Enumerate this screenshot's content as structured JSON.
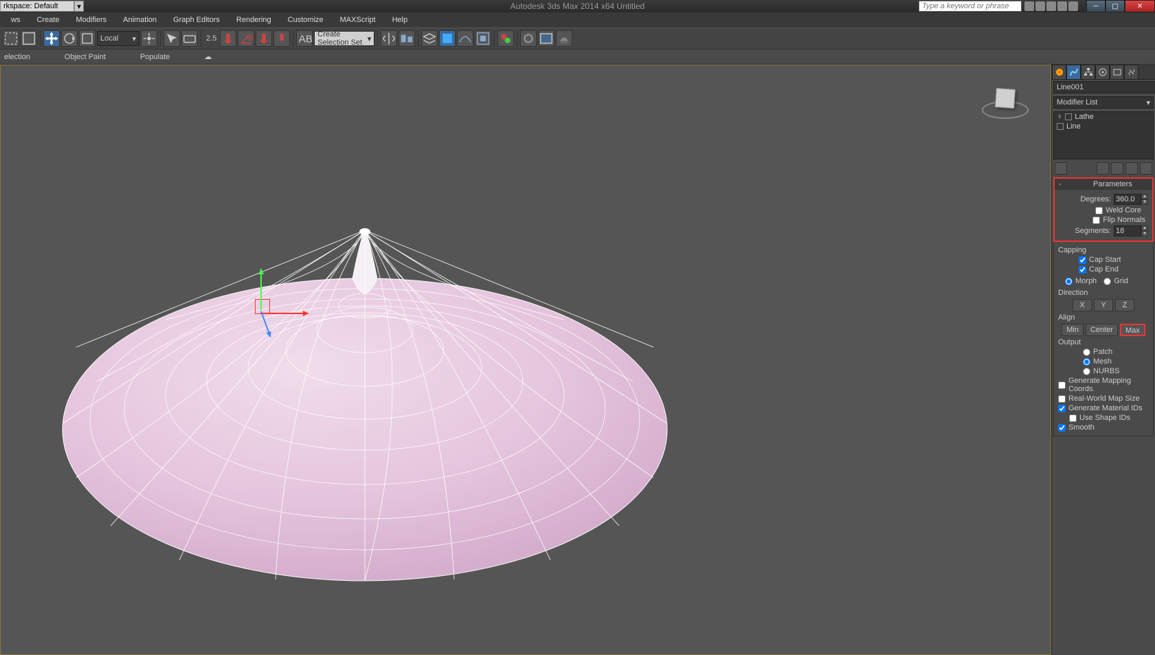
{
  "titlebar": {
    "workspace_label": "rkspace: Default",
    "app_title": "Autodesk 3ds Max 2014 x64   Untitled",
    "search_placeholder": "Type a keyword or phrase"
  },
  "menu": {
    "items": [
      "ws",
      "Create",
      "Modifiers",
      "Animation",
      "Graph Editors",
      "Rendering",
      "Customize",
      "MAXScript",
      "Help"
    ]
  },
  "toolbar": {
    "coord_system": "Local",
    "snap_value": "2.5",
    "selection_set_text": "Create Selection Set"
  },
  "subtoolbar": {
    "items": [
      "election",
      "Object Paint",
      "Populate"
    ]
  },
  "command_panel": {
    "object_name": "Line001",
    "modifier_list_label": "Modifier List",
    "stack": [
      "Lathe",
      "Line"
    ],
    "parameters": {
      "header": "Parameters",
      "degrees_label": "Degrees:",
      "degrees_value": "360.0",
      "weld_core": "Weld Core",
      "flip_normals": "Flip Normals",
      "segments_label": "Segments:",
      "segments_value": "18",
      "capping_label": "Capping",
      "cap_start": "Cap Start",
      "cap_end": "Cap End",
      "morph": "Morph",
      "grid": "Grid",
      "direction_label": "Direction",
      "x_label": "X",
      "y_label": "Y",
      "z_label": "Z",
      "align_label": "Align",
      "min_label": "Min",
      "center_label": "Center",
      "max_label": "Max",
      "output_label": "Output",
      "patch": "Patch",
      "mesh": "Mesh",
      "nurbs": "NURBS",
      "gen_mapping": "Generate Mapping Coords.",
      "real_world": "Real-World Map Size",
      "gen_material": "Generate Material IDs",
      "use_shape": "Use Shape IDs",
      "smooth": "Smooth"
    }
  }
}
